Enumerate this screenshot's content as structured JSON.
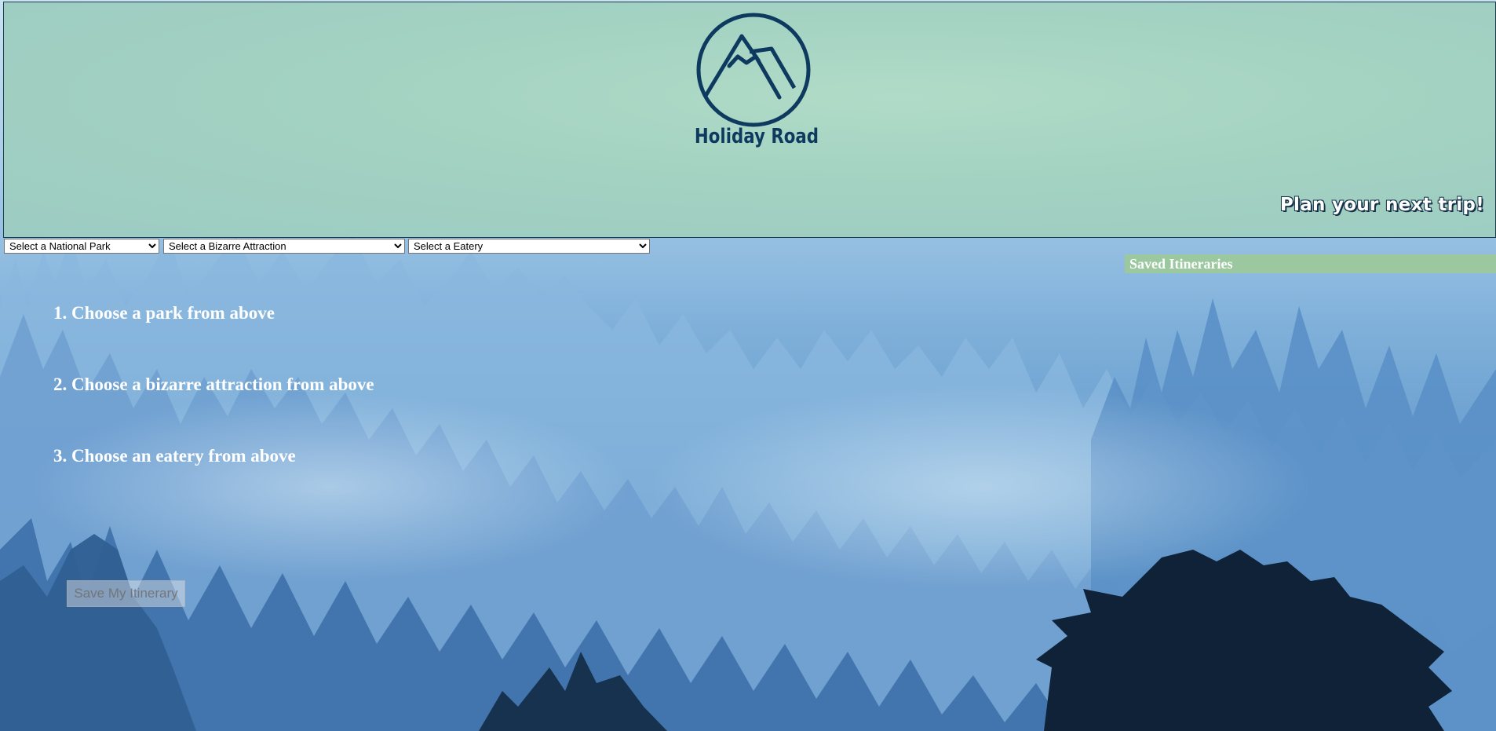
{
  "header": {
    "brand": "Holiday Road",
    "tagline": "Plan your next trip!",
    "logo_icon": "mountain-circle-icon"
  },
  "filters": {
    "park_placeholder": "Select a National Park",
    "attraction_placeholder": "Select a Bizarre Attraction",
    "eatery_placeholder": "Select a Eatery"
  },
  "steps": [
    "1. Choose a park from above",
    "2. Choose a bizarre attraction from above",
    "3. Choose an eatery from above"
  ],
  "save_button": {
    "label": "Save My Itinerary"
  },
  "saved_panel": {
    "title": "Saved Itineraries"
  },
  "colors": {
    "header_bg": "#a3d2c2",
    "brand": "#0f3a5f",
    "saved_panel_bg": "#9bc89f",
    "forest_dark": "#0f2237"
  }
}
